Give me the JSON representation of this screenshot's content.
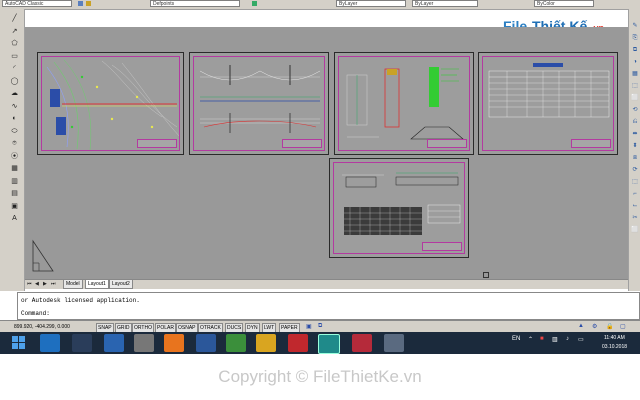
{
  "toolbar": {
    "workspace_label": "AutoCAD Classic",
    "layer_value": "Defpoints",
    "linetype_value": "ByLayer",
    "lineweight_value": "ByLayer",
    "color_value": "ByColor"
  },
  "logo": {
    "text_file": "File",
    "text_rest": "Thiết Kế",
    "text_tld": ".vn"
  },
  "left_tools": [
    "╱",
    "↗",
    "⬠",
    "▭",
    "◜",
    "◯",
    "☁",
    "∿",
    "◐",
    "⬭",
    "⌾",
    "⦿",
    "▦",
    "▥",
    "▤",
    "▣",
    "A"
  ],
  "right_tools": [
    "✎",
    "⎘",
    "⧉",
    "◑",
    "▦",
    "⬚",
    "⬜",
    "⟲",
    "⎌",
    "⬌",
    "⬍",
    "⧈",
    "⟳",
    "⬚",
    "⌐",
    "⌙",
    "✂",
    "⬜"
  ],
  "sheets": [
    {
      "name": "site-plan"
    },
    {
      "name": "bridge-elevation"
    },
    {
      "name": "cross-section"
    },
    {
      "name": "quantity-table"
    },
    {
      "name": "detail-sheet"
    }
  ],
  "layout_tabs": [
    "Model",
    "Layout1",
    "Layout2"
  ],
  "command": {
    "history": "or Autodesk licensed application.",
    "prompt": "Command:"
  },
  "status": {
    "coords": "899.920, -404.299, 0.000",
    "toggles": [
      "SNAP",
      "GRID",
      "ORTHO",
      "POLAR",
      "OSNAP",
      "OTRACK",
      "DUCS",
      "DYN",
      "LWT",
      "PAPER"
    ]
  },
  "taskbar": {
    "lang": "EN",
    "time": "11:40 AM",
    "date": "03.10.2018"
  },
  "footer": {
    "copyright": "Copyright © FileThietKe.vn"
  },
  "colors": {
    "canvas": "#999999",
    "viewport_border": "#b33aa0",
    "taskbar": "#1b2a3c"
  }
}
